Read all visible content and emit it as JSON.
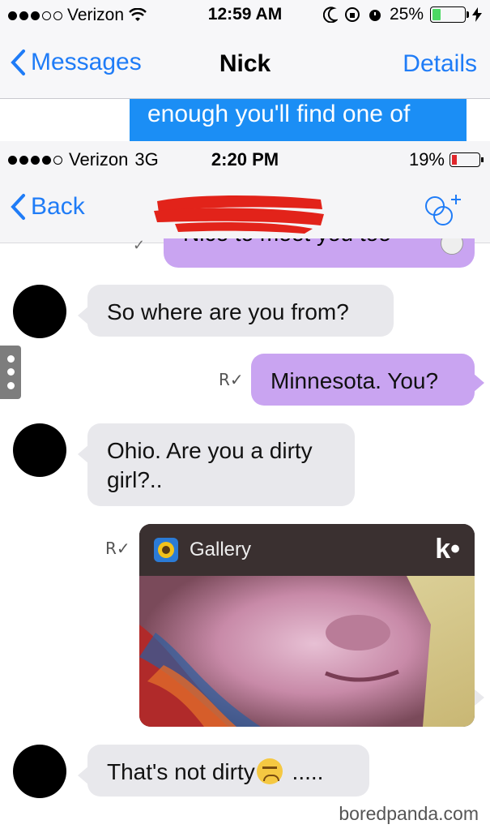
{
  "imessage": {
    "status": {
      "carrier": "Verizon",
      "time": "12:59 AM",
      "battery": "25%"
    },
    "nav": {
      "back_label": "Messages",
      "title": "Nick",
      "details_label": "Details"
    },
    "partial_bubble_text": "enough you'll find one of"
  },
  "kik": {
    "status": {
      "carrier": "Verizon",
      "network": "3G",
      "time": "2:20 PM",
      "battery": "19%"
    },
    "nav": {
      "back_label": "Back"
    },
    "messages": [
      {
        "from": "me",
        "text": "Nice to meet you too"
      },
      {
        "from": "them",
        "text": "So where are you from?"
      },
      {
        "from": "me",
        "text": "Minnesota. You?",
        "receipt": "R"
      },
      {
        "from": "them",
        "text": "Ohio. Are you a dirty girl?.."
      },
      {
        "from": "them",
        "text": "That's not dirty",
        "suffix": " ....."
      }
    ],
    "gallery": {
      "label": "Gallery",
      "logo": "k•",
      "receipt": "R"
    }
  },
  "watermark": "boredpanda.com",
  "colors": {
    "ios_blue": "#1f7cf7",
    "imessage_bubble": "#1b8ef5",
    "kik_out_bubble": "#c9a4f1",
    "kik_in_bubble": "#e8e8ec"
  }
}
